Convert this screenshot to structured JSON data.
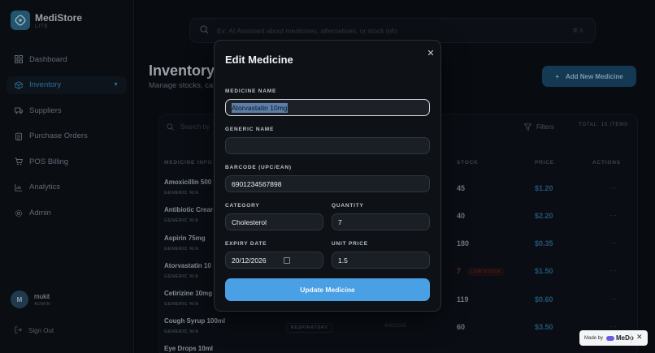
{
  "app": {
    "name": "MediStore",
    "subtitle": "LITE"
  },
  "sidebar": {
    "items": [
      {
        "label": "Dashboard",
        "icon": "grid-icon"
      },
      {
        "label": "Inventory",
        "icon": "box-icon"
      },
      {
        "label": "Suppliers",
        "icon": "truck-icon"
      },
      {
        "label": "Purchase Orders",
        "icon": "clipboard-icon"
      },
      {
        "label": "POS Billing",
        "icon": "cart-icon"
      },
      {
        "label": "Analytics",
        "icon": "chart-icon"
      },
      {
        "label": "Admin",
        "icon": "gear-icon"
      }
    ],
    "user": {
      "initial": "M",
      "name": "mukit",
      "role": "ADMIN"
    },
    "signout": "Sign Out"
  },
  "search": {
    "placeholder": "Ex: AI Assistant about medicines, alternatives, or stock info",
    "shortcut": "⌘ K"
  },
  "page": {
    "title": "Inventory",
    "subtitle": "Manage stocks, cat",
    "add_button": "Add New Medicine"
  },
  "table": {
    "search_placeholder": "Search by",
    "filters": "Filters",
    "total": "TOTAL: 15 ITEMS",
    "headers": {
      "medicine": "MEDICINE INFO",
      "stock": "STOCK",
      "price": "PRICE",
      "actions": "ACTIONS"
    },
    "rows": [
      {
        "name": "Amoxicillin 500",
        "generic": "GENERIC N/A",
        "stock": "45",
        "price": "$1.20"
      },
      {
        "name": "Antibiotic Crear",
        "generic": "GENERIC N/A",
        "stock": "40",
        "price": "$2.20"
      },
      {
        "name": "Aspirin 75mg",
        "generic": "GENERIC N/A",
        "stock": "180",
        "price": "$0.35"
      },
      {
        "name": "Atorvastatin 10",
        "generic": "GENERIC N/A",
        "stock": "7",
        "price": "$1.50"
      },
      {
        "name": "Cetirizine 10mg",
        "generic": "GENERIC N/A",
        "stock": "119",
        "price": "$0.60"
      },
      {
        "name": "Cough Syrup 100ml",
        "generic": "GENERIC N/A",
        "stock": "60",
        "price": "$3.50"
      },
      {
        "name": "Eye Drops 10ml",
        "generic": "",
        "stock": "",
        "price": ""
      }
    ],
    "low_stock": "LOW STOCK",
    "category_badge": "RESPIRATORY",
    "expiry_fragment": "4/30/2026",
    "action_glyph": "···"
  },
  "modal": {
    "title": "Edit Medicine",
    "fields": {
      "medicine_name": {
        "label": "MEDICINE NAME",
        "value": "Atorvastatin 10mg"
      },
      "generic_name": {
        "label": "GENERIC NAME",
        "value": ""
      },
      "barcode": {
        "label": "BARCODE (UPC/EAN)",
        "value": "6901234567898"
      },
      "category": {
        "label": "CATEGORY",
        "value": "Cholesterol"
      },
      "quantity": {
        "label": "QUANTITY",
        "value": "7"
      },
      "expiry": {
        "label": "EXPIRY DATE",
        "value": "20/12/2026"
      },
      "unit_price": {
        "label": "UNIT PRICE",
        "value": "1.5"
      }
    },
    "submit": "Update Medicine"
  },
  "badge": {
    "made_by": "Made by",
    "brand": "MeDo"
  },
  "colors": {
    "accent": "#4aa0e4",
    "background": "#0b0f15",
    "modal": "#0e1116"
  }
}
